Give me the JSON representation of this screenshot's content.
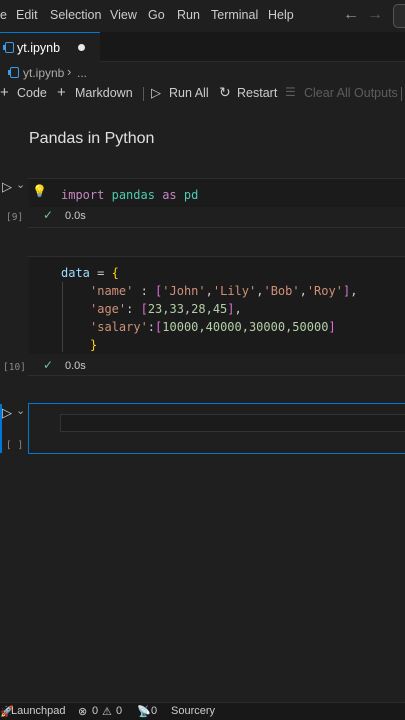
{
  "menu": {
    "partial_first": "e",
    "items": [
      "Edit",
      "Selection",
      "View",
      "Go",
      "Run",
      "Terminal",
      "Help"
    ]
  },
  "nav": {
    "back_icon": "arrow-left-icon",
    "forward_icon": "arrow-right-icon"
  },
  "tab": {
    "filename": "yt.ipynb",
    "dirty": true
  },
  "breadcrumb": {
    "file": "yt.ipynb",
    "separator": "›",
    "more": "..."
  },
  "toolbar": {
    "code_label": "Code",
    "markdown_label": "Markdown",
    "run_all_label": "Run All",
    "restart_label": "Restart",
    "clear_outputs_label": "Clear All Outputs"
  },
  "notebook": {
    "heading": "Pandas in Python",
    "cell1": {
      "exec_count": "[9]",
      "code": {
        "kw1": "import",
        "mod": "pandas",
        "kw2": "as",
        "alias": "pd"
      },
      "status_time": "0.0s"
    },
    "cell2": {
      "exec_count": "[10]",
      "lines": {
        "l1_var": "data",
        "l1_op": " = ",
        "l1_brace": "{",
        "l2_key": "'name'",
        "l2_mid": " : ",
        "l2_open": "[",
        "l2_v1": "'John'",
        "l2_v2": "'Lily'",
        "l2_v3": "'Bob'",
        "l2_v4": "'Roy'",
        "l2_close": "]",
        "l2_end": ",",
        "l3_key": "'age'",
        "l3_mid": ": ",
        "l3_open": "[",
        "l3_vals": "23,33,28,45",
        "l3_close": "]",
        "l3_end": ",",
        "l4_key": "'salary'",
        "l4_mid": ":",
        "l4_open": "[",
        "l4_vals": "10000,40000,30000,50000",
        "l4_close": "]",
        "l5_brace": "}"
      },
      "status_time": "0.0s"
    },
    "cell3": {
      "exec_count": "[ ]"
    }
  },
  "statusbar": {
    "launchpad": "Launchpad",
    "errors": "0",
    "warnings": "0",
    "ports": "0",
    "sourcery": "Sourcery"
  },
  "colors": {
    "accent": "#0078d4",
    "success": "#73c991",
    "keyword": "#c586c0",
    "string": "#ce9178",
    "number": "#b5cea8"
  }
}
